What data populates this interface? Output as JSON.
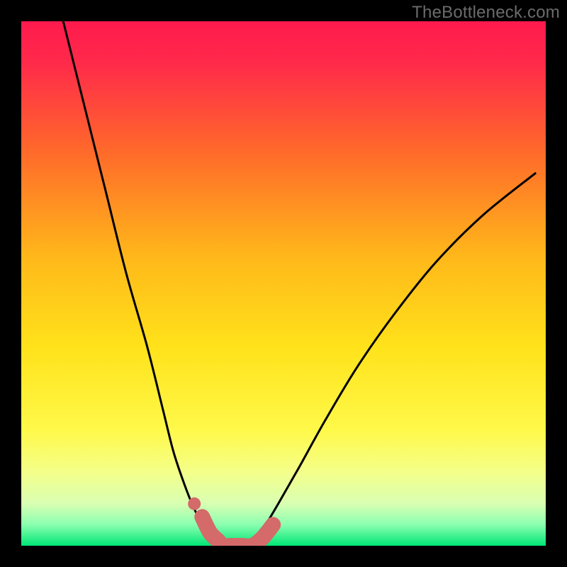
{
  "watermark": "TheBottleneck.com",
  "chart_data": {
    "type": "line",
    "title": "",
    "xlabel": "",
    "ylabel": "",
    "xlim": [
      0,
      100
    ],
    "ylim": [
      0,
      100
    ],
    "background_gradient": {
      "top": "#ff1a4d",
      "upper_mid": "#ff7a1a",
      "mid": "#ffe21a",
      "lower_mid": "#f7ff66",
      "bottom_band": "#d9ffb3",
      "bottom": "#00e676"
    },
    "series": [
      {
        "name": "left-curve",
        "x": [
          8,
          12,
          16,
          20,
          24,
          27,
          29,
          31,
          33,
          34.5,
          36,
          37.5,
          38.5
        ],
        "y": [
          100,
          84,
          68,
          52,
          38,
          26,
          18,
          12,
          7,
          4.5,
          2.5,
          1,
          0
        ]
      },
      {
        "name": "right-curve",
        "x": [
          44,
          46,
          49,
          53,
          58,
          64,
          71,
          79,
          88,
          98
        ],
        "y": [
          0,
          3,
          8,
          15,
          24,
          34,
          44,
          54,
          63,
          71
        ]
      },
      {
        "name": "bottom-flat",
        "x": [
          38.5,
          40,
          42,
          44
        ],
        "y": [
          0,
          0,
          0,
          0
        ]
      }
    ],
    "highlight_band": {
      "name": "pink-thick-segment",
      "color": "#d46a6a",
      "points_x": [
        34.5,
        36,
        37.5,
        38.5,
        40,
        42,
        44,
        46,
        48
      ],
      "points_y": [
        5.5,
        2.5,
        1,
        0,
        0,
        0,
        0,
        1.5,
        4
      ],
      "dot": {
        "x": 33,
        "y": 8
      }
    }
  }
}
